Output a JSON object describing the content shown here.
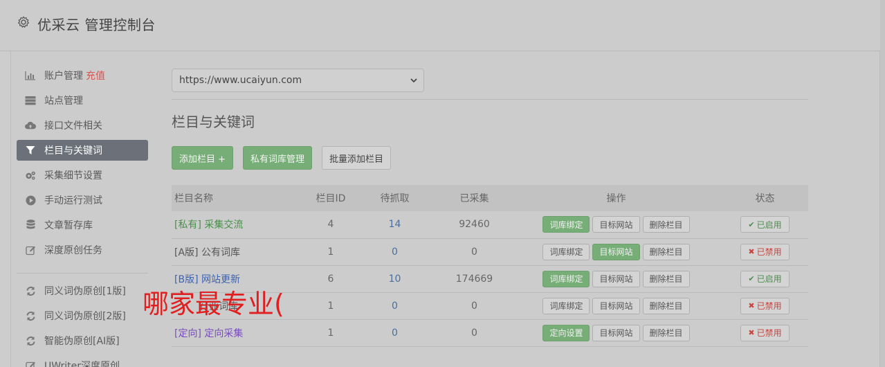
{
  "header": {
    "title": "优采云 管理控制台",
    "icon": "gear-icon"
  },
  "sidebar": {
    "items": [
      {
        "label": "账户管理",
        "extra": "充值",
        "icon": "bar-chart-icon"
      },
      {
        "label": "站点管理",
        "icon": "server-icon"
      },
      {
        "label": "接口文件相关",
        "icon": "cloud-upload-icon"
      },
      {
        "label": "栏目与关键词",
        "icon": "filter-icon",
        "active": true
      },
      {
        "label": "采集细节设置",
        "icon": "cogs-icon"
      },
      {
        "label": "手动运行测试",
        "icon": "play-circle-icon"
      },
      {
        "label": "文章暂存库",
        "icon": "database-icon"
      },
      {
        "label": "深度原创任务",
        "icon": "edit-icon"
      }
    ],
    "items2": [
      {
        "label": "同义词伪原创[1版]",
        "icon": "refresh-icon"
      },
      {
        "label": "同义词伪原创[2版]",
        "icon": "refresh-icon"
      },
      {
        "label": "智能伪原创[AI版]",
        "icon": "refresh-icon"
      },
      {
        "label": "UWriter深度原创",
        "icon": "edit-icon"
      }
    ]
  },
  "main": {
    "site_select": "https://www.ucaiyun.com",
    "section_title": "栏目与关键词",
    "buttons": {
      "add_column": "添加栏目 +",
      "private_lib": "私有词库管理",
      "batch_add": "批量添加栏目"
    },
    "table": {
      "headers": [
        "栏目名称",
        "栏目ID",
        "待抓取",
        "已采集",
        "操作",
        "状态"
      ],
      "rows": [
        {
          "tag": "[私有]",
          "name": "采集交流",
          "id": "4",
          "pending": "14",
          "collected": "92460",
          "op1": "词库绑定",
          "op2": "目标网站",
          "op3": "删除栏目",
          "status": "已启用"
        },
        {
          "tag": "[A版]",
          "name": "公有词库",
          "id": "1",
          "pending": "0",
          "collected": "0",
          "op1": "词库绑定",
          "op2": "目标网站",
          "op3": "删除栏目",
          "status": "已禁用"
        },
        {
          "tag": "[B版]",
          "name": "网站更新",
          "id": "6",
          "pending": "10",
          "collected": "174669",
          "op1": "词库绑定",
          "op2": "目标网站",
          "op3": "删除栏目",
          "status": "已启用"
        },
        {
          "tag": "",
          "name": "行业词库",
          "id": "1",
          "pending": "0",
          "collected": "0",
          "op1": "词库绑定",
          "op2": "目标网站",
          "op3": "删除栏目",
          "status": "已禁用"
        },
        {
          "tag": "[定向]",
          "name": "定向采集",
          "id": "1",
          "pending": "0",
          "collected": "0",
          "op1": "定向设置",
          "op2": "目标网站",
          "op3": "删除栏目",
          "status": "已禁用"
        }
      ]
    }
  },
  "overlay_text": "哪家最专业(",
  "colors": {
    "active_nav": "#6b7079",
    "green_btn": "#77ad77",
    "red_text": "#d9534f",
    "overlay_red": "#e02020"
  }
}
